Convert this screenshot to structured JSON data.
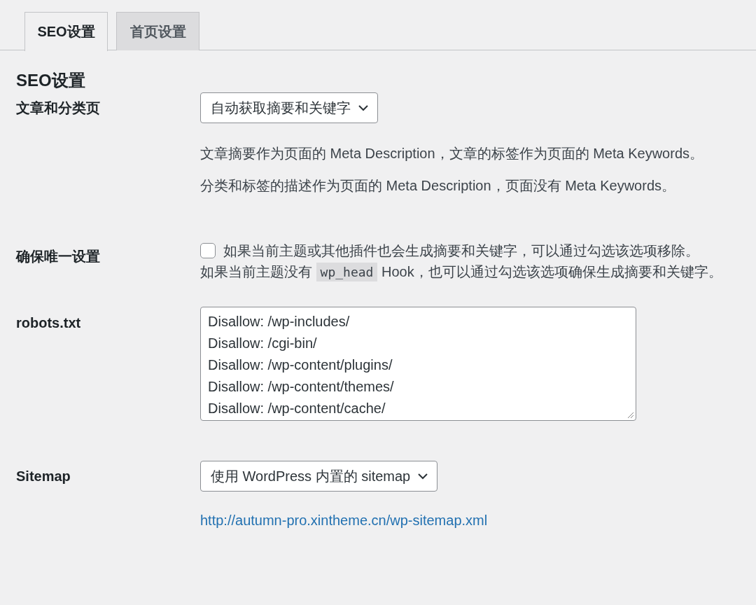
{
  "tabs": [
    {
      "label": "SEO设置",
      "selected": true
    },
    {
      "label": "首页设置",
      "selected": false
    }
  ],
  "heading": "SEO设置",
  "rows": [
    {
      "kind": "select",
      "label": "文章和分类页",
      "value": "自动获取摘要和关键字",
      "notes": [
        "文章摘要作为页面的 Meta Description，文章的标签作为页面的 Meta Keywords。",
        "分类和标签的描述作为页面的 Meta Description，页面没有 Meta Keywords。"
      ]
    },
    {
      "kind": "checkbox",
      "label": "确保唯一设置",
      "checked": false,
      "text": "如果当前主题或其他插件也会生成摘要和关键字，可以通过勾选该选项移除。",
      "note": [
        {
          "kind": "text",
          "text": "如果当前主题没有 "
        },
        {
          "kind": "code",
          "text": "wp_head"
        },
        {
          "kind": "text",
          "text": " Hook，也可以通过勾选该选项确保生成摘要和关键字。"
        }
      ]
    },
    {
      "kind": "textarea",
      "label": "robots.txt",
      "lines": [
        "Disallow: /wp-includes/",
        "Disallow: /cgi-bin/",
        "Disallow: /wp-content/plugins/",
        "Disallow: /wp-content/themes/",
        "Disallow: /wp-content/cache/"
      ]
    },
    {
      "kind": "select",
      "label": "Sitemap",
      "value": "使用 WordPress 内置的 sitemap",
      "link": "http://autumn-pro.xintheme.cn/wp-sitemap.xml"
    }
  ]
}
